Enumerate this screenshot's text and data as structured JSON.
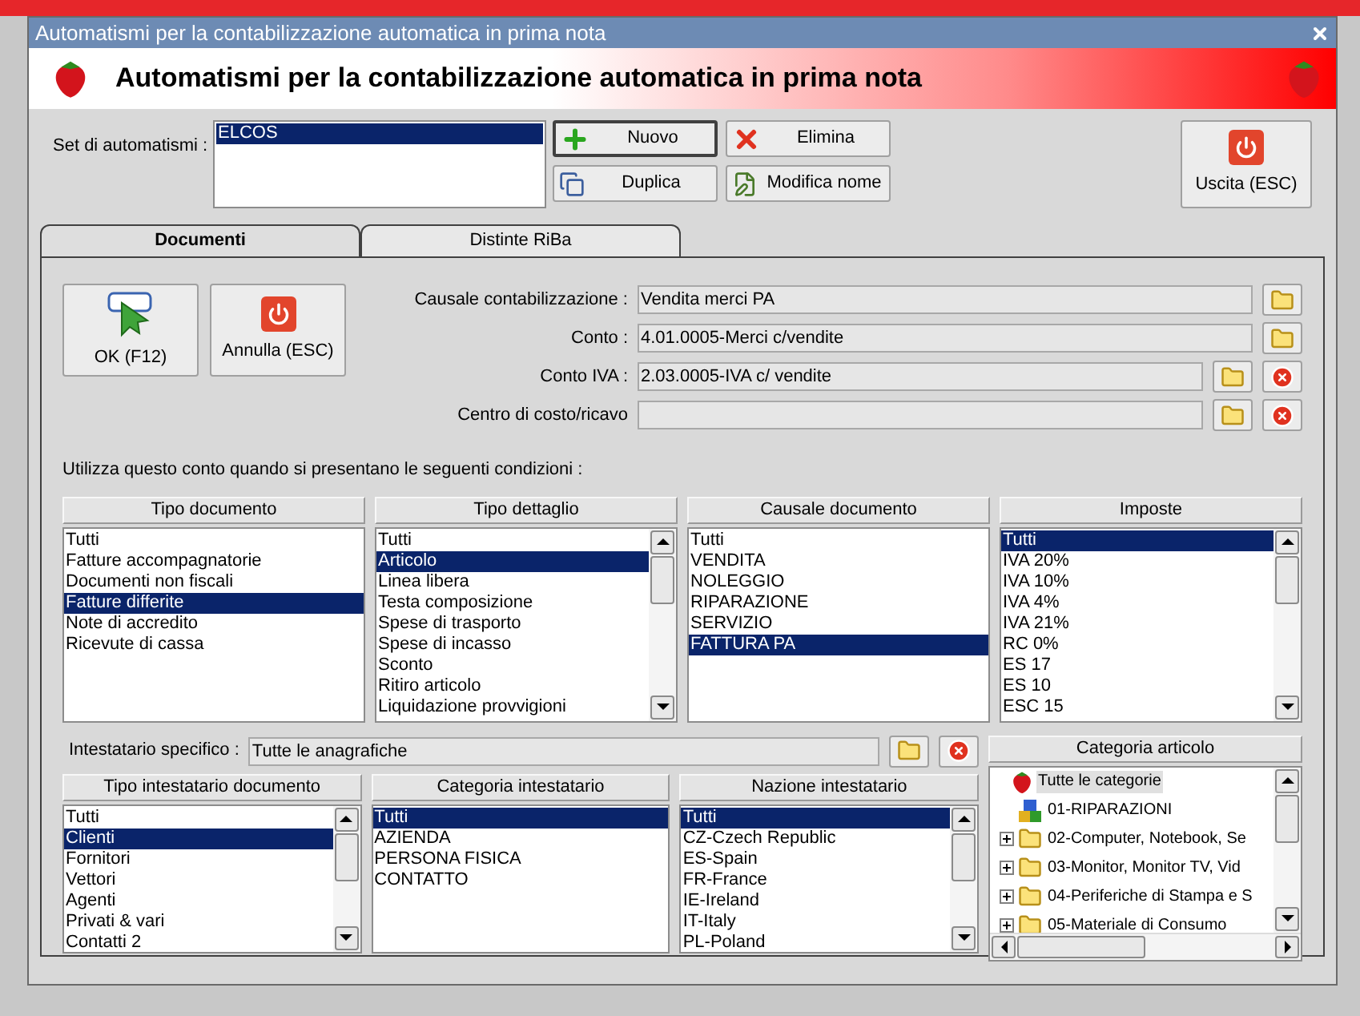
{
  "window": {
    "title": "Automatismi per la contabilizzazione automatica in prima nota"
  },
  "header": {
    "title": "Automatismi per la contabilizzazione automatica in prima nota"
  },
  "set": {
    "label": "Set di automatismi :",
    "items": [
      {
        "label": "ELCOS",
        "selected": true
      }
    ]
  },
  "buttons": [
    {
      "label": "Nuovo",
      "kind": "add",
      "focused": true
    },
    {
      "label": "Elimina",
      "kind": "delete",
      "focused": false
    },
    {
      "label": "Duplica",
      "kind": "duplicate",
      "focused": false
    },
    {
      "label": "Modifica nome",
      "kind": "rename",
      "focused": false
    }
  ],
  "exit_button": {
    "label": "Uscita (ESC)"
  },
  "tabs": [
    {
      "label": "Documenti",
      "selected": true
    },
    {
      "label": "Distinte RiBa",
      "selected": false
    }
  ],
  "actions": [
    {
      "label": "OK (F12)",
      "kind": "ok"
    },
    {
      "label": "Annulla (ESC)",
      "kind": "cancel"
    }
  ],
  "fields": [
    {
      "label": "Causale contabilizzazione :",
      "value": "Vendita merci PA",
      "clearable": false
    },
    {
      "label": "Conto :",
      "value": "4.01.0005-Merci c/vendite",
      "clearable": false
    },
    {
      "label": "Conto IVA :",
      "value": "2.03.0005-IVA c/ vendite",
      "clearable": true
    },
    {
      "label": "Centro di costo/ricavo",
      "clearable": true
    }
  ],
  "conditions_label": "Utilizza questo conto quando si presentano le seguenti condizioni :",
  "upper_lists": [
    {
      "heading": "Tipo documento",
      "scrollable": false,
      "items": [
        {
          "label": "Tutti",
          "selected": false
        },
        {
          "label": "Fatture accompagnatorie",
          "selected": false
        },
        {
          "label": "Documenti non fiscali",
          "selected": false
        },
        {
          "label": "Fatture differite",
          "selected": true
        },
        {
          "label": "Note di accredito",
          "selected": false
        },
        {
          "label": "Ricevute di cassa",
          "selected": false
        }
      ]
    },
    {
      "heading": "Tipo dettaglio",
      "scrollable": true,
      "items": [
        {
          "label": "Tutti",
          "selected": false
        },
        {
          "label": "Articolo",
          "selected": true
        },
        {
          "label": "Linea libera",
          "selected": false
        },
        {
          "label": "Testa composizione",
          "selected": false
        },
        {
          "label": "Spese di trasporto",
          "selected": false
        },
        {
          "label": "Spese di incasso",
          "selected": false
        },
        {
          "label": "Sconto",
          "selected": false
        },
        {
          "label": "Ritiro articolo",
          "selected": false
        },
        {
          "label": "Liquidazione provvigioni",
          "selected": false
        }
      ]
    },
    {
      "heading": "Causale documento",
      "scrollable": false,
      "items": [
        {
          "label": "Tutti",
          "selected": false
        },
        {
          "label": "VENDITA",
          "selected": false
        },
        {
          "label": "NOLEGGIO",
          "selected": false
        },
        {
          "label": "RIPARAZIONE",
          "selected": false
        },
        {
          "label": "SERVIZIO",
          "selected": false
        },
        {
          "label": "FATTURA PA",
          "selected": true
        }
      ]
    },
    {
      "heading": "Imposte",
      "scrollable": true,
      "items": [
        {
          "label": "Tutti",
          "selected": true
        },
        {
          "label": "IVA 20%",
          "selected": false
        },
        {
          "label": "IVA 10%",
          "selected": false
        },
        {
          "label": "IVA 4%",
          "selected": false
        },
        {
          "label": "IVA 21%",
          "selected": false
        },
        {
          "label": "RC 0%",
          "selected": false
        },
        {
          "label": "ES 17",
          "selected": false
        },
        {
          "label": "ES 10",
          "selected": false
        },
        {
          "label": "ESC 15",
          "selected": false
        }
      ]
    }
  ],
  "holder": {
    "label": "Intestatario specifico :",
    "value": "Tutte le anagrafiche"
  },
  "lower_lists": [
    {
      "heading": "Tipo intestatario documento",
      "scrollable": true,
      "items": [
        {
          "label": "Tutti",
          "selected": false
        },
        {
          "label": "Clienti",
          "selected": true
        },
        {
          "label": "Fornitori",
          "selected": false
        },
        {
          "label": "Vettori",
          "selected": false
        },
        {
          "label": "Agenti",
          "selected": false
        },
        {
          "label": "Privati & vari",
          "selected": false
        },
        {
          "label": "Contatti 2",
          "selected": false
        }
      ]
    },
    {
      "heading": "Categoria intestatario",
      "scrollable": false,
      "items": [
        {
          "label": "Tutti",
          "selected": true
        },
        {
          "label": "AZIENDA",
          "selected": false
        },
        {
          "label": "PERSONA FISICA",
          "selected": false
        },
        {
          "label": "CONTATTO",
          "selected": false
        }
      ]
    },
    {
      "heading": "Nazione intestatario",
      "scrollable": true,
      "items": [
        {
          "label": "Tutti",
          "selected": true
        },
        {
          "label": "CZ-Czech Republic",
          "selected": false
        },
        {
          "label": "ES-Spain",
          "selected": false
        },
        {
          "label": "FR-France",
          "selected": false
        },
        {
          "label": "IE-Ireland",
          "selected": false
        },
        {
          "label": "IT-Italy",
          "selected": false
        },
        {
          "label": "PL-Poland",
          "selected": false
        }
      ]
    }
  ],
  "category_tree": {
    "heading": "Categoria articolo",
    "items": [
      {
        "label": "Tutte le categorie",
        "kind": "root",
        "selected": true,
        "expanded": true,
        "children": [
          {
            "label": "01-RIPARAZIONI",
            "kind": "group",
            "selected": false
          },
          {
            "label": "02-Computer, Notebook, Se",
            "kind": "folder",
            "selected": false,
            "expanded": false
          },
          {
            "label": "03-Monitor, Monitor TV, Vid",
            "kind": "folder",
            "selected": false,
            "expanded": false
          },
          {
            "label": "04-Periferiche di Stampa e S",
            "kind": "folder",
            "selected": false,
            "expanded": false
          },
          {
            "label": "05-Materiale di Consumo",
            "kind": "folder",
            "selected": false,
            "expanded": false
          }
        ]
      }
    ]
  }
}
